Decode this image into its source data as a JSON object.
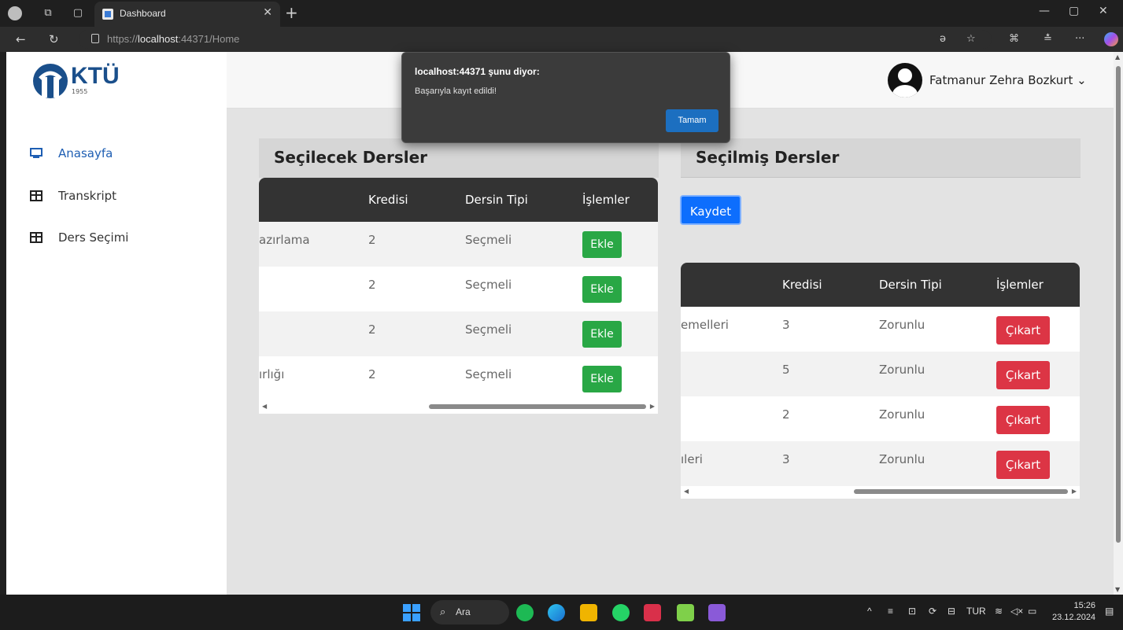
{
  "browser": {
    "tab_title": "Dashboard",
    "url_prefix": "https://",
    "url_host": "localhost",
    "url_rest": ":44371/Home"
  },
  "sidebar": {
    "logo_text": "KTÜ",
    "logo_year": "1955",
    "items": [
      {
        "label": "Anasayfa",
        "icon": "monitor-icon",
        "active": true
      },
      {
        "label": "Transkript",
        "icon": "table-icon"
      },
      {
        "label": "Ders Seçimi",
        "icon": "table-icon"
      }
    ]
  },
  "header": {
    "user_name": "Fatmanur Zehra Bozkurt",
    "chevron": "⌄"
  },
  "available_courses": {
    "title": "Seçilecek Dersler",
    "columns": [
      "Kredisi",
      "Dersin Tipi",
      "İşlemler"
    ],
    "rows": [
      {
        "name": "azırlama",
        "credit": "2",
        "type": "Seçmeli",
        "action": "Ekle"
      },
      {
        "name": "",
        "credit": "2",
        "type": "Seçmeli",
        "action": "Ekle"
      },
      {
        "name": "",
        "credit": "2",
        "type": "Seçmeli",
        "action": "Ekle"
      },
      {
        "name": "ırlığı",
        "credit": "2",
        "type": "Seçmeli",
        "action": "Ekle"
      }
    ]
  },
  "selected_courses": {
    "title": "Seçilmiş Dersler",
    "save_label": "Kaydet",
    "columns": [
      "Kredisi",
      "Dersin Tipi",
      "İşlemler"
    ],
    "rows": [
      {
        "name": "emelleri",
        "credit": "3",
        "type": "Zorunlu",
        "action": "Çıkart"
      },
      {
        "name": "",
        "credit": "5",
        "type": "Zorunlu",
        "action": "Çıkart"
      },
      {
        "name": "",
        "credit": "2",
        "type": "Zorunlu",
        "action": "Çıkart"
      },
      {
        "name": "ıleri",
        "credit": "3",
        "type": "Zorunlu",
        "action": "Çıkart"
      }
    ]
  },
  "dialog": {
    "title": "localhost:44371 şunu diyor:",
    "message": "Başarıyla kayıt edildi!",
    "ok_label": "Tamam"
  },
  "taskbar": {
    "search_label": "Ara",
    "language": "TUR",
    "time": "15:26",
    "date": "23.12.2024"
  },
  "colors": {
    "primary_blue": "#0d6efd",
    "add_green": "#29a745",
    "remove_red": "#dc3545",
    "table_header": "#333333"
  }
}
